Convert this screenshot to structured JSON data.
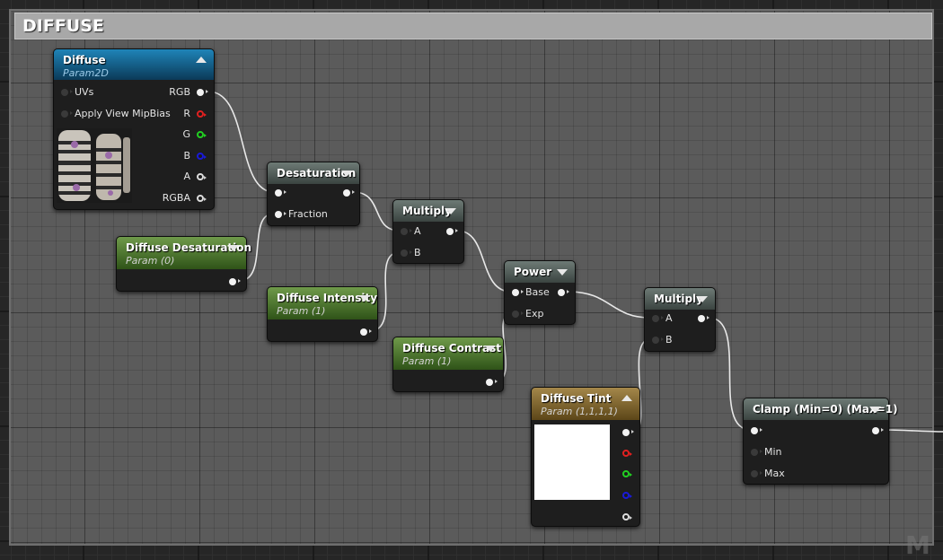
{
  "comment": {
    "title": "DIFFUSE"
  },
  "nodes": {
    "diffuse_texture": {
      "title": "Diffuse",
      "subtitle": "Param2D",
      "inputs": [
        "UVs",
        "Apply View MipBias"
      ],
      "outputs": [
        "RGB",
        "R",
        "G",
        "B",
        "A",
        "RGBA"
      ]
    },
    "desaturation": {
      "title": "Desaturation",
      "inputs": [
        "Fraction"
      ]
    },
    "diffuse_desaturation": {
      "title": "Diffuse Desaturation",
      "subtitle": "Param (0)"
    },
    "multiply_1": {
      "title": "Multiply",
      "inputs": [
        "A",
        "B"
      ]
    },
    "diffuse_intensity": {
      "title": "Diffuse Intensity",
      "subtitle": "Param (1)"
    },
    "power": {
      "title": "Power",
      "inputs": [
        "Base",
        "Exp"
      ]
    },
    "diffuse_contrast": {
      "title": "Diffuse Contrast",
      "subtitle": "Param (1)"
    },
    "multiply_2": {
      "title": "Multiply",
      "inputs": [
        "A",
        "B"
      ]
    },
    "diffuse_tint": {
      "title": "Diffuse Tint",
      "subtitle": "Param (1,1,1,1)"
    },
    "clamp": {
      "title": "Clamp (Min=0) (Max=1)",
      "inputs": [
        "Min",
        "Max"
      ]
    }
  },
  "colors": {
    "header_parameter": "#4f7a2c",
    "header_math": "#4f5a56",
    "header_texture": "#156a9a",
    "header_vector": "#7d6630",
    "pin_r": "#e02020",
    "pin_g": "#22d022",
    "pin_b": "#1a1ad8"
  }
}
